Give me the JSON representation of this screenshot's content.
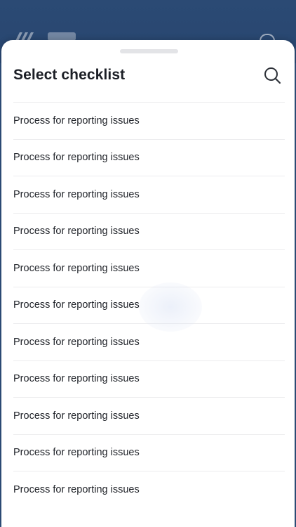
{
  "sheet": {
    "title": "Select checklist",
    "search_icon": "search-icon"
  },
  "checklists": [
    {
      "label": "Process for reporting issues"
    },
    {
      "label": "Process for reporting issues"
    },
    {
      "label": "Process for reporting issues"
    },
    {
      "label": "Process for reporting issues"
    },
    {
      "label": "Process for reporting issues"
    },
    {
      "label": "Process for reporting issues"
    },
    {
      "label": "Process for reporting issues"
    },
    {
      "label": "Process for reporting issues"
    },
    {
      "label": "Process for reporting issues"
    },
    {
      "label": "Process for reporting issues"
    },
    {
      "label": "Process for reporting issues"
    }
  ],
  "colors": {
    "header_background": "#2b4a74",
    "sheet_background": "#ffffff",
    "title_text": "#1b1e25",
    "item_text": "#22252b",
    "divider": "#ececee"
  }
}
